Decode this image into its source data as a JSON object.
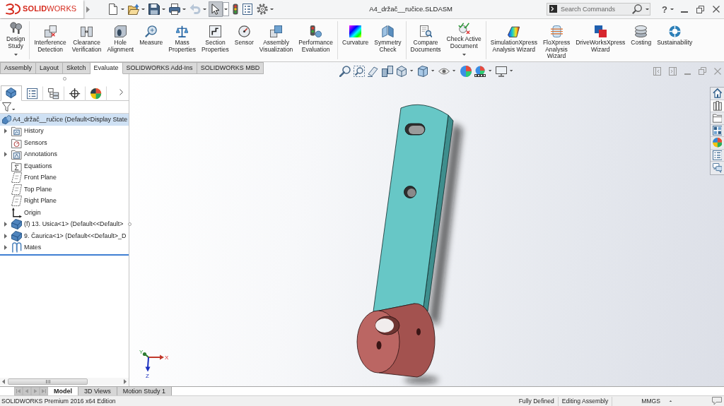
{
  "title_bar": {
    "logo": "**SOLID**WORKS",
    "quick_access": [
      {
        "kind": "new",
        "menu": true,
        "selected": false,
        "disabled": false
      },
      {
        "kind": "open",
        "menu": true,
        "selected": false,
        "disabled": false
      },
      {
        "kind": "save",
        "menu": true,
        "selected": false,
        "disabled": false
      },
      {
        "kind": "print",
        "menu": true,
        "selected": false,
        "disabled": false
      },
      {
        "kind": "undo",
        "menu": true,
        "selected": false,
        "disabled": true
      },
      {
        "kind": "select",
        "menu": true,
        "selected": true,
        "disabled": false
      },
      {
        "kind": "rebuild",
        "menu": false,
        "selected": false,
        "disabled": false
      },
      {
        "kind": "file-properties",
        "menu": false,
        "selected": false,
        "disabled": false
      },
      {
        "kind": "options",
        "menu": true,
        "selected": false,
        "disabled": false
      }
    ],
    "document_title": "A4_držač__ručice.SLDASM",
    "search": {
      "placeholder": "Search Commands"
    },
    "help": "?"
  },
  "ribbon": {
    "groups": [
      {
        "buttons": [
          {
            "kind": "design-study",
            "label": "Design\nStudy",
            "menu": true
          }
        ]
      },
      {
        "buttons": [
          {
            "kind": "interference",
            "label": "Interference\nDetection",
            "menu": false
          },
          {
            "kind": "clearance",
            "label": "Clearance\nVerification",
            "menu": false
          },
          {
            "kind": "hole-alignment",
            "label": "Hole\nAlignment",
            "menu": false
          },
          {
            "kind": "measure",
            "label": "Measure",
            "menu": false
          },
          {
            "kind": "mass-properties",
            "label": "Mass\nProperties",
            "menu": false
          },
          {
            "kind": "section-properties",
            "label": "Section\nProperties",
            "menu": false
          },
          {
            "kind": "sensor",
            "label": "Sensor",
            "menu": false
          },
          {
            "kind": "assembly-visualization",
            "label": "Assembly\nVisualization",
            "menu": false
          },
          {
            "kind": "performance",
            "label": "Performance\nEvaluation",
            "menu": false
          }
        ]
      },
      {
        "buttons": [
          {
            "kind": "curvature",
            "label": "Curvature",
            "menu": false
          },
          {
            "kind": "symmetry",
            "label": "Symmetry\nCheck",
            "menu": false
          }
        ]
      },
      {
        "buttons": [
          {
            "kind": "compare",
            "label": "Compare\nDocuments",
            "menu": false
          },
          {
            "kind": "check-document",
            "label": "Check Active\nDocument",
            "menu": true
          }
        ]
      },
      {
        "buttons": [
          {
            "kind": "simulationxpress",
            "label": "SimulationXpress\nAnalysis Wizard",
            "menu": false
          },
          {
            "kind": "floxpress",
            "label": "FloXpress\nAnalysis\nWizard",
            "menu": false
          },
          {
            "kind": "driveworks",
            "label": "DriveWorksXpress\nWizard",
            "menu": false
          },
          {
            "kind": "costing",
            "label": "Costing",
            "menu": false
          },
          {
            "kind": "sustainability",
            "label": "Sustainability",
            "menu": false
          }
        ]
      }
    ]
  },
  "command_tabs": [
    {
      "label": "Assembly",
      "selected": false
    },
    {
      "label": "Layout",
      "selected": false
    },
    {
      "label": "Sketch",
      "selected": false
    },
    {
      "label": "Evaluate",
      "selected": true
    },
    {
      "label": "SOLIDWORKS Add-Ins",
      "selected": false
    },
    {
      "label": "SOLIDWORKS MBD",
      "selected": false
    }
  ],
  "feature_manager": {
    "tabs": [
      {
        "kind": "feature-tree",
        "selected": true
      },
      {
        "kind": "property",
        "selected": false
      },
      {
        "kind": "configuration",
        "selected": false
      },
      {
        "kind": "dimxpert",
        "selected": false
      },
      {
        "kind": "display",
        "selected": false
      }
    ],
    "tree": {
      "kind": "assembly",
      "label": "A4_držač__ručice (Default<Display State",
      "selected": true,
      "children": [
        {
          "kind": "history",
          "label": "History",
          "expanded": false,
          "selected": false
        },
        {
          "kind": "sensors",
          "label": "Sensors",
          "selected": false
        },
        {
          "kind": "annotations",
          "label": "Annotations",
          "expanded": false,
          "selected": false
        },
        {
          "kind": "equations",
          "label": "Equations",
          "selected": false
        },
        {
          "kind": "plane",
          "label": "Front Plane",
          "selected": false
        },
        {
          "kind": "plane",
          "label": "Top Plane",
          "selected": false
        },
        {
          "kind": "plane",
          "label": "Right Plane",
          "selected": false
        },
        {
          "kind": "origin",
          "label": "Origin",
          "selected": false
        },
        {
          "kind": "part",
          "label": "(f) 13. Usica<1> (Default<<Default>",
          "expanded": false,
          "selected": false
        },
        {
          "kind": "part",
          "label": "9. Čaurica<1> (Default<<Default>_D",
          "expanded": false,
          "selected": false
        },
        {
          "kind": "mates",
          "label": "Mates",
          "expanded": false,
          "selected": false
        }
      ]
    }
  },
  "view_toolbar": [
    {
      "kind": "zoom-to-fit",
      "menu": false
    },
    {
      "kind": "zoom-to-area",
      "menu": false
    },
    {
      "kind": "previous-view",
      "menu": false
    },
    {
      "kind": "section-view",
      "menu": false
    },
    {
      "kind": "view-orientation",
      "menu": true
    },
    {
      "kind": "display-style",
      "menu": true
    },
    {
      "kind": "hide-show",
      "menu": true
    },
    {
      "kind": "edit-appearance",
      "menu": false
    },
    {
      "kind": "apply-scene",
      "menu": true
    },
    {
      "kind": "view-settings",
      "menu": true
    }
  ],
  "task_pane": [
    {
      "kind": "home",
      "selected": false
    },
    {
      "kind": "design-library",
      "selected": true
    },
    {
      "kind": "file-explorer",
      "selected": false
    },
    {
      "kind": "view-palette",
      "selected": false
    },
    {
      "kind": "appearances",
      "selected": false
    },
    {
      "kind": "custom-properties",
      "selected": false
    },
    {
      "kind": "forum",
      "selected": false
    }
  ],
  "triad": {
    "x": "X",
    "y": "Y",
    "z": "Z"
  },
  "tab_scroll_buttons": {
    "disabled": true
  },
  "bottom_tabs": [
    {
      "label": "Model",
      "selected": true
    },
    {
      "label": "3D Views",
      "selected": false
    },
    {
      "label": "Motion Study 1",
      "selected": false
    }
  ],
  "status_bar": {
    "product": "SOLIDWORKS Premium 2016 x64 Edition",
    "state": "Fully Defined",
    "mode": "Editing Assembly",
    "units": "MMGS"
  }
}
